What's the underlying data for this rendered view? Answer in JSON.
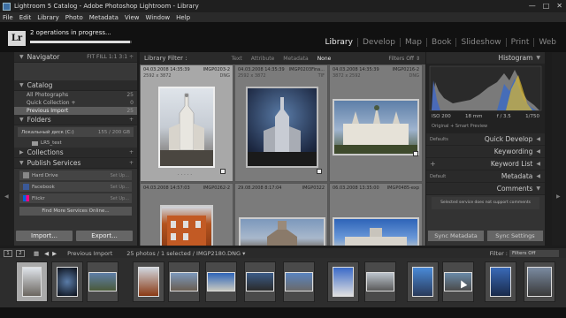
{
  "window": {
    "title": "Lightroom 5 Catalog - Adobe Photoshop Lightroom - Library"
  },
  "menu": [
    "File",
    "Edit",
    "Library",
    "Photo",
    "Metadata",
    "View",
    "Window",
    "Help"
  ],
  "identity": {
    "logo_text": "Lr",
    "progress_text": "2 operations in progress...",
    "progress_value": 0.98
  },
  "modules": [
    "Library",
    "Develop",
    "Map",
    "Book",
    "Slideshow",
    "Print",
    "Web"
  ],
  "left_panel": {
    "navigator": {
      "label": "Navigator",
      "zoom_options": "FIT  FILL  1:1  3:1 ÷"
    },
    "catalog": {
      "label": "Catalog",
      "items": [
        {
          "label": "All Photographs",
          "count": "25"
        },
        {
          "label": "Quick Collection +",
          "count": "0"
        },
        {
          "label": "Previous Import",
          "count": "25"
        }
      ]
    },
    "folders": {
      "label": "Folders",
      "volume": "Локальный диск (C:)",
      "volume_size": "155 / 200 GB",
      "subfolder": "LR5_test"
    },
    "collections": {
      "label": "Collections"
    },
    "publish": {
      "label": "Publish Services",
      "services": [
        {
          "label": "Hard Drive",
          "setup": "Set Up..."
        },
        {
          "label": "Facebook",
          "setup": "Set Up..."
        },
        {
          "label": "Flickr",
          "setup": "Set Up..."
        }
      ],
      "find_more": "Find More Services Online..."
    },
    "import_label": "Import...",
    "export_label": "Export..."
  },
  "library_filter": {
    "label": "Library Filter :",
    "options": [
      "Text",
      "Attribute",
      "Metadata",
      "None"
    ],
    "selected": "None",
    "filters_off": "Filters Off ⇕"
  },
  "grid": [
    {
      "date": "04.03.2008 14:35:39",
      "name": "IMGP0203-2",
      "dims": "2592 x 3872",
      "ext": "DNG",
      "orient": "portrait",
      "selected": true
    },
    {
      "date": "04.03.2008 14:35:39",
      "name": "IMGP0203Fina...",
      "dims": "2592 x 3872",
      "ext": "TIF",
      "orient": "portrait",
      "selected": false
    },
    {
      "date": "04.03.2008 14:35:39",
      "name": "IMGP0216-2",
      "dims": "3872 x 2592",
      "ext": "DNG",
      "orient": "landscape",
      "selected": false
    },
    {
      "date": "04.03.2008 14:57:03",
      "name": "IMGP0262-2",
      "dims": "",
      "ext": "",
      "orient": "portrait",
      "selected": false
    },
    {
      "date": "29.08.2008 8:17:04",
      "name": "IMGP0322",
      "dims": "",
      "ext": "",
      "orient": "landscape",
      "selected": false
    },
    {
      "date": "06.03.2008 13:35:00",
      "name": "IMGP0485-exp",
      "dims": "",
      "ext": "",
      "orient": "landscape",
      "selected": false
    }
  ],
  "right_panel": {
    "histogram": {
      "label": "Histogram",
      "iso": "ISO 200",
      "focal": "18 mm",
      "aperture": "f / 3.5",
      "shutter": "1/750",
      "preview": "Original + Smart Preview"
    },
    "sections": [
      {
        "label": "Quick Develop",
        "left": "Defaults"
      },
      {
        "label": "Keywording",
        "left": ""
      },
      {
        "label": "Keyword List",
        "left": "+"
      },
      {
        "label": "Metadata",
        "left": "Default"
      },
      {
        "label": "Comments",
        "left": ""
      }
    ],
    "comments_note": "Selected service does not support comments",
    "sync_metadata": "Sync Metadata",
    "sync_settings": "Sync Settings"
  },
  "filmstrip": {
    "pages": [
      "1",
      "2"
    ],
    "source": "Previous Import",
    "count_text": "25 photos / 1 selected / IMGP2180.DNG ▾",
    "filter_label": "Filter :",
    "filter_value": "Filters Off"
  },
  "colors": {
    "accent": "#dddddd",
    "panel": "#333333",
    "grid_bg": "#5a5a5a"
  }
}
